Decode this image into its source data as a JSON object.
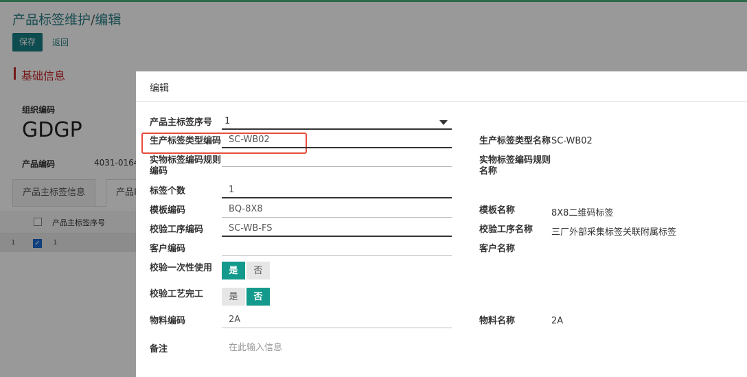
{
  "page": {
    "title_main": "产品标签维护",
    "title_sep": "/",
    "title_sub": "编辑",
    "save_label": "保存",
    "back_label": "返回",
    "section_title": "基础信息",
    "org_label": "组织编码",
    "org_value": "GDGP",
    "product_code_label": "产品编码",
    "product_code_value": "4031-0164",
    "tabs": [
      "产品主标签信息",
      "产品I"
    ],
    "table_header": "产品主标签序号",
    "row": {
      "num": "1",
      "value": "1"
    }
  },
  "dialog": {
    "title": "编辑",
    "fields": {
      "main_seq": {
        "label": "产品主标签序号",
        "value": "1"
      },
      "type_code": {
        "label": "生产标签类型编码",
        "value": "SC-WB02"
      },
      "type_name": {
        "label": "生产标签类型名称",
        "value": "SC-WB02"
      },
      "rule_code": {
        "label": "实物标签编码规则编码",
        "value": ""
      },
      "rule_name": {
        "label": "实物标签编码规则名称",
        "value": ""
      },
      "count": {
        "label": "标签个数",
        "value": "1"
      },
      "template_code": {
        "label": "模板编码",
        "value": "BQ-8X8"
      },
      "template_name": {
        "label": "模板名称",
        "value": "8X8二维码标签"
      },
      "process_code": {
        "label": "校验工序编码",
        "value": "SC-WB-FS"
      },
      "process_name": {
        "label": "校验工序名称",
        "value": "三厂外部采集标签关联附属标签"
      },
      "customer_code": {
        "label": "客户编码",
        "value": ""
      },
      "customer_name": {
        "label": "客户名称",
        "value": ""
      },
      "one_time": {
        "label": "校验一次性使用",
        "yes": "是",
        "no": "否",
        "selected": "是"
      },
      "process_done": {
        "label": "校验工艺完工",
        "yes": "是",
        "no": "否",
        "selected": "否"
      },
      "material_code": {
        "label": "物料编码",
        "value": "2A"
      },
      "material_name": {
        "label": "物料名称",
        "value": "2A"
      },
      "remark": {
        "label": "备注",
        "placeholder": "在此输入信息"
      }
    }
  },
  "colors": {
    "accent": "#149a8c",
    "title": "#2a7f86",
    "section": "#c62828",
    "highlight": "#e74c3c"
  }
}
